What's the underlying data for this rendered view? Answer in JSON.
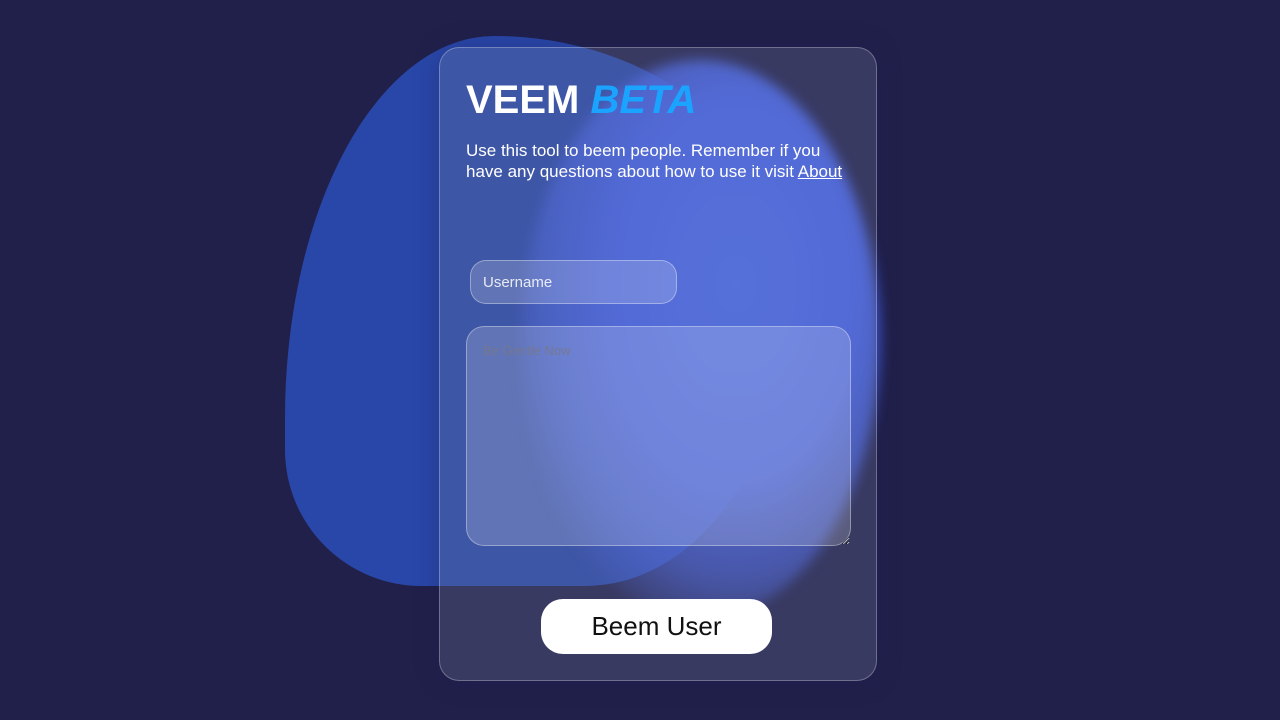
{
  "app": {
    "title_main": "VEEM",
    "title_badge": "BETA",
    "description": "Use this tool to beem people. Remember if you have any questions about how to use it visit",
    "about_link": "About"
  },
  "form": {
    "username_placeholder": "Username",
    "username_value": "",
    "message_placeholder": "Be Gentle Now",
    "message_value": "",
    "submit_label": "Beem User"
  },
  "colors": {
    "background": "#21204a",
    "accent_beta": "#1aa3ff",
    "blob_blue": "#2a4bb0",
    "glow_blue": "#4a6cf0",
    "button_bg": "#ffffff"
  }
}
